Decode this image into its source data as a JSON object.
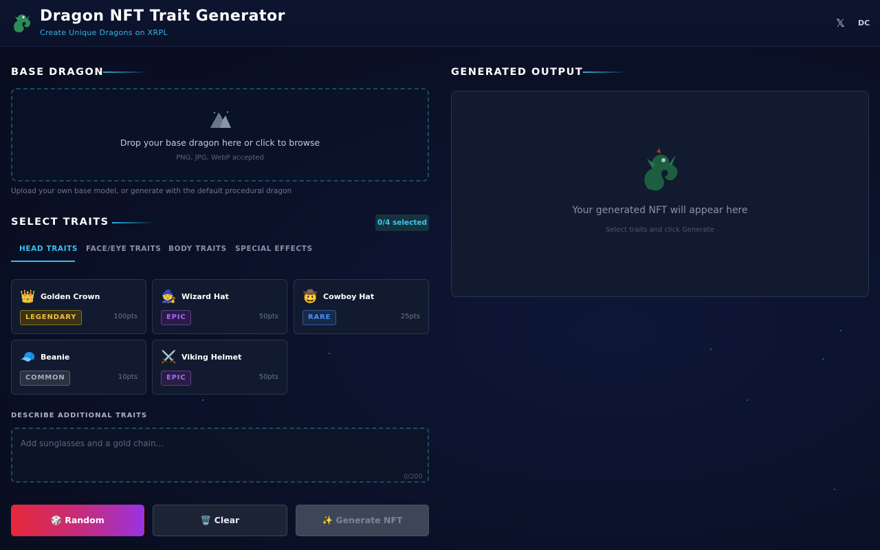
{
  "header": {
    "title": "Dragon NFT Trait Generator",
    "subtitle": "Create Unique Dragons on XRPL",
    "x_label": "𝕏",
    "dc_label": "DC"
  },
  "base_dragon": {
    "heading": "BASE DRAGON",
    "drop_text": "Drop your base dragon here or click to browse",
    "accepted": "PNG, JPG, WebP accepted",
    "hint": "Upload your own base model, or generate with the default procedural dragon"
  },
  "traits": {
    "heading": "SELECT TRAITS",
    "selected_count": "0/4 selected",
    "tabs": [
      {
        "label": "HEAD TRAITS",
        "active": true
      },
      {
        "label": "FACE/EYE TRAITS",
        "active": false
      },
      {
        "label": "BODY TRAITS",
        "active": false
      },
      {
        "label": "SPECIAL EFFECTS",
        "active": false
      }
    ],
    "items": [
      {
        "emoji": "👑",
        "name": "Golden Crown",
        "rarity": "LEGENDARY",
        "points": "100pts"
      },
      {
        "emoji": "🧙",
        "name": "Wizard Hat",
        "rarity": "EPIC",
        "points": "50pts"
      },
      {
        "emoji": "🤠",
        "name": "Cowboy Hat",
        "rarity": "RARE",
        "points": "25pts"
      },
      {
        "emoji": "🧢",
        "name": "Beanie",
        "rarity": "COMMON",
        "points": "10pts"
      },
      {
        "emoji": "⚔️",
        "name": "Viking Helmet",
        "rarity": "EPIC",
        "points": "50pts"
      }
    ]
  },
  "description": {
    "label": "DESCRIBE ADDITIONAL TRAITS",
    "placeholder": "Add sunglasses and a gold chain...",
    "char_count": "0/200"
  },
  "actions": {
    "random_label": "🎲 Random",
    "clear_label": "🗑️ Clear",
    "generate_label": "✨ Generate NFT"
  },
  "output": {
    "heading": "GENERATED OUTPUT",
    "empty_text": "Your generated NFT will appear here",
    "empty_sub": "Select traits and click Generate"
  },
  "colors": {
    "accent": "#38c0ef",
    "legendary": "#f0c23a",
    "epic": "#a66bf0",
    "rare": "#4a8ff5",
    "common": "#a7aebe"
  }
}
